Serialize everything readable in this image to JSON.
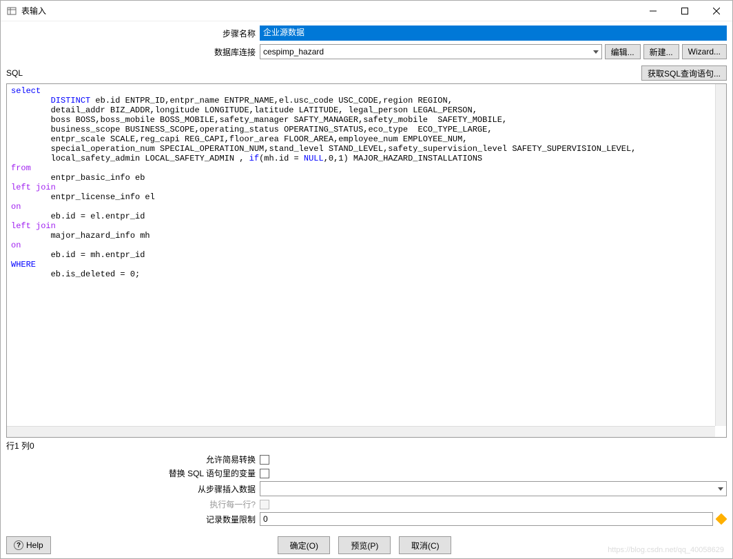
{
  "window": {
    "title": "表输入"
  },
  "form": {
    "step_name_label": "步骤名称",
    "step_name_value": "企业源数据",
    "db_conn_label": "数据库连接",
    "db_conn_value": "cespimp_hazard",
    "edit_btn": "编辑...",
    "new_btn": "新建...",
    "wizard_btn": "Wizard..."
  },
  "sql": {
    "label": "SQL",
    "get_sql_btn": "获取SQL查询语句...",
    "position": "行1 列0",
    "tokens": [
      {
        "t": "select",
        "c": "kw-blue",
        "nl": true
      },
      {
        "t": "        ",
        "c": ""
      },
      {
        "t": "DISTINCT",
        "c": "kw-blue"
      },
      {
        "t": " eb.id ENTPR_ID,entpr_name ENTPR_NAME,el.usc_code USC_CODE,region REGION,",
        "nl": true
      },
      {
        "t": "        detail_addr BIZ_ADDR,longitude LONGITUDE,latitude LATITUDE, legal_person LEGAL_PERSON,",
        "nl": true
      },
      {
        "t": "        boss BOSS,boss_mobile BOSS_MOBILE,safety_manager SAFTY_MANAGER,safety_mobile  SAFETY_MOBILE,",
        "nl": true
      },
      {
        "t": "        business_scope BUSINESS_SCOPE,operating_status OPERATING_STATUS,eco_type  ECO_TYPE_LARGE,",
        "nl": true
      },
      {
        "t": "        entpr_scale SCALE,reg_capi REG_CAPI,floor_area FLOOR_AREA,employee_num EMPLOYEE_NUM,",
        "nl": true
      },
      {
        "t": "        special_operation_num SPECIAL_OPERATION_NUM,stand_level STAND_LEVEL,safety_supervision_level SAFETY_SUPERVISION_LEVEL,",
        "nl": true
      },
      {
        "t": "        local_safety_admin LOCAL_SAFETY_ADMIN , "
      },
      {
        "t": "if",
        "c": "kw-blue"
      },
      {
        "t": "(mh.id = "
      },
      {
        "t": "NULL",
        "c": "kw-blue"
      },
      {
        "t": ",0,1) MAJOR_HAZARD_INSTALLATIONS",
        "nl": true
      },
      {
        "t": "from",
        "c": "kw-purple",
        "nl": true
      },
      {
        "t": "        entpr_basic_info eb",
        "nl": true
      },
      {
        "t": "left join",
        "c": "kw-purple",
        "nl": true
      },
      {
        "t": "        entpr_license_info el",
        "nl": true
      },
      {
        "t": "on",
        "c": "kw-purple",
        "nl": true
      },
      {
        "t": "        eb.id = el.entpr_id",
        "nl": true
      },
      {
        "t": "left join",
        "c": "kw-purple",
        "nl": true
      },
      {
        "t": "        major_hazard_info mh",
        "nl": true
      },
      {
        "t": "on",
        "c": "kw-purple",
        "nl": true
      },
      {
        "t": "        eb.id = mh.entpr_id",
        "nl": true
      },
      {
        "t": "WHERE",
        "c": "kw-blue",
        "nl": true
      },
      {
        "t": "        eb.is_deleted = 0;"
      }
    ]
  },
  "options": {
    "allow_lazy": "允许简易转换",
    "replace_vars": "替换 SQL 语句里的变量",
    "insert_from_step": "从步骤插入数据",
    "insert_from_step_value": "",
    "exec_each_row": "执行每一行?",
    "record_limit": "记录数量限制",
    "record_limit_value": "0"
  },
  "buttons": {
    "help": "Help",
    "ok": "确定(O)",
    "preview": "预览(P)",
    "cancel": "取消(C)"
  },
  "watermark": "https://blog.csdn.net/qq_40058629"
}
